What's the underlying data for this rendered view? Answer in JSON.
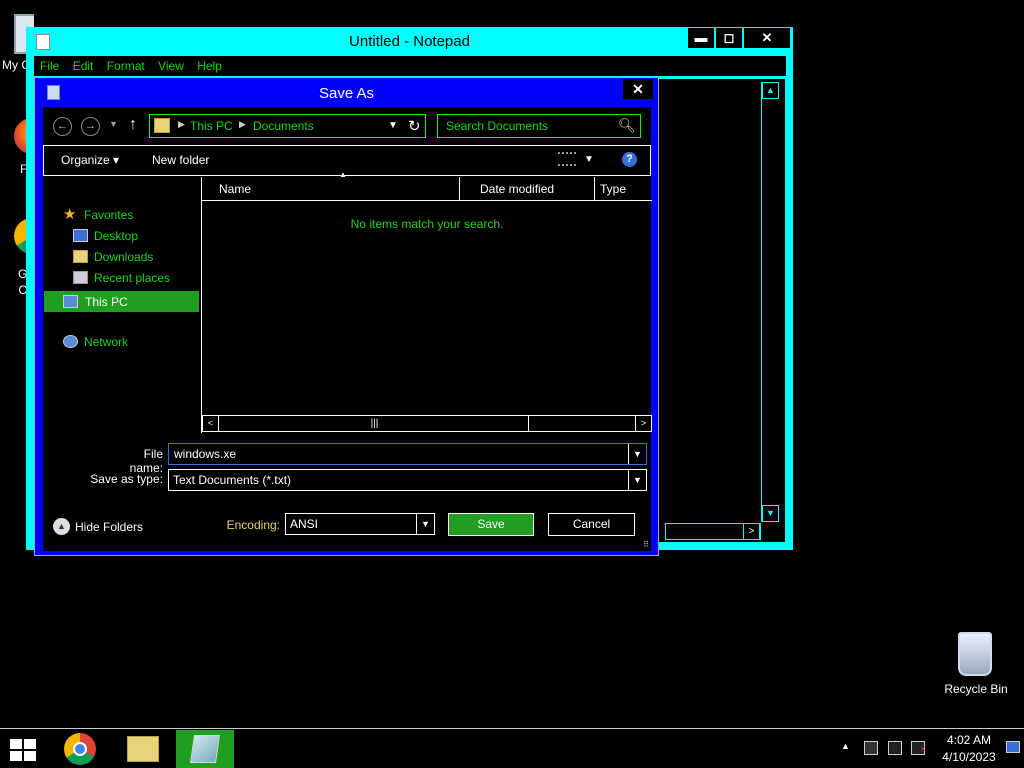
{
  "desktop": {
    "icons": [
      {
        "label": "My C",
        "icon": "computer-icon"
      },
      {
        "label": "F",
        "icon": "firefox-icon"
      },
      {
        "label": "G\nC",
        "icon": "chrome-icon"
      },
      {
        "label": "Recycle Bin",
        "icon": "recycle-bin-icon"
      }
    ]
  },
  "notepad": {
    "title": "Untitled - Notepad",
    "controls": {
      "minimize": "▬",
      "maximize": "◻",
      "close": "✕"
    },
    "menu": [
      "File",
      "Edit",
      "Format",
      "View",
      "Help"
    ],
    "scroll": {
      "up": "▲",
      "down": "▼",
      "right": ">"
    }
  },
  "dialog": {
    "title": "Save As",
    "close": "✕",
    "nav": {
      "back": "←",
      "forward": "→",
      "recent": "▼",
      "up": "↑"
    },
    "address": {
      "crumbs": [
        "This PC",
        "Documents"
      ],
      "sep": "▶",
      "dropdown": "▼",
      "refresh": "↻"
    },
    "search": {
      "placeholder": "Search Documents",
      "icon": "search-icon"
    },
    "toolbar": {
      "organize": "Organize ▾",
      "new_folder": "New folder",
      "view_dd": "▼",
      "help": "?"
    },
    "nav_pane": {
      "favorites": "Favorites",
      "desktop": "Desktop",
      "downloads": "Downloads",
      "recent": "Recent places",
      "this_pc": "This PC",
      "network": "Network",
      "star": "★"
    },
    "file_list": {
      "columns": [
        "Name",
        "Date modified",
        "Type"
      ],
      "sort_arrow": "▲",
      "empty_message": "No items match your search.",
      "scroll": {
        "left": "<",
        "right": ">",
        "thumb": "|||"
      }
    },
    "form": {
      "file_name_label": "File name:",
      "file_name_value": "windows.xe",
      "save_as_type_label": "Save as type:",
      "save_as_type_value": "Text Documents (*.txt)",
      "hide_folders": "Hide Folders",
      "encoding_label": "Encoding:",
      "encoding_value": "ANSI",
      "save": "Save",
      "cancel": "Cancel",
      "dropdown": "▼",
      "hide_icon": "▲",
      "grip": "⠿"
    }
  },
  "taskbar": {
    "apps": [
      "chrome-icon",
      "file-explorer-icon",
      "notepad-icon"
    ],
    "tray_up": "▲",
    "time": "4:02 AM",
    "date": "4/10/2023"
  },
  "colors": {
    "notepad_frame": "#00ffff",
    "dialog_frame": "#0000ff",
    "accent_green": "#19d419",
    "selection_green": "#1f9e1f"
  }
}
